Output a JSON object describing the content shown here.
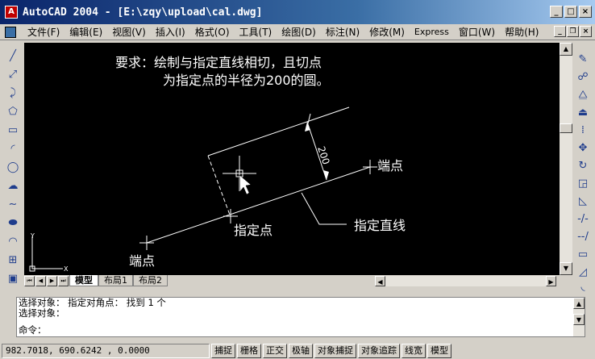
{
  "window": {
    "title": "AutoCAD 2004 - [E:\\zqy\\upload\\cal.dwg]",
    "controls": [
      "_",
      "□",
      "×"
    ]
  },
  "menubar": {
    "items": [
      "文件(F)",
      "编辑(E)",
      "视图(V)",
      "插入(I)",
      "格式(O)",
      "工具(T)",
      "绘图(D)",
      "标注(N)",
      "修改(M)",
      "Express",
      "窗口(W)",
      "帮助(H)"
    ],
    "doc_controls": [
      "_",
      "❐",
      "×"
    ]
  },
  "drawing": {
    "requirement_line1": "要求：绘制与指定直线相切，且切点",
    "requirement_line2": "为指定点的半径为200的圆。",
    "dimension_label": "200",
    "endpoint_top_label": "端点",
    "endpoint_bottom_label": "端点",
    "specified_point_label": "指定点",
    "specified_line_label": "指定直线",
    "ucs_x": "X",
    "ucs_y": "Y"
  },
  "layout_tabs": [
    "模型",
    "布局1",
    "布局2"
  ],
  "command": {
    "line1": "选择对象： 指定对角点： 找到 1 个",
    "line2": "选择对象：",
    "prompt": "命令："
  },
  "status": {
    "coordinates": "982.7018,  690.6242 , 0.0000",
    "toggles": [
      "捕捉",
      "栅格",
      "正交",
      "极轴",
      "对象捕捉",
      "对象追踪",
      "线宽",
      "模型"
    ]
  },
  "icons": {
    "left_toolbar": [
      "line-icon",
      "construction-line-icon",
      "polyline-icon",
      "polygon-icon",
      "rectangle-icon",
      "arc-icon",
      "circle-icon",
      "revision-cloud-icon",
      "spline-icon",
      "ellipse-icon",
      "ellipse-arc-icon",
      "insert-block-icon",
      "make-block-icon"
    ],
    "right_toolbar": [
      "erase-icon",
      "copy-icon",
      "mirror-icon",
      "offset-icon",
      "array-icon",
      "move-icon",
      "rotate-icon",
      "scale-icon",
      "stretch-icon",
      "trim-icon",
      "extend-icon",
      "break-icon",
      "chamfer-icon",
      "fillet-icon"
    ]
  }
}
